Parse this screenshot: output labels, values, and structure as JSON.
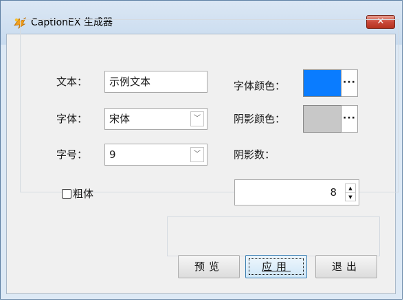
{
  "window": {
    "title": "CaptionEX 生成器",
    "close_glyph": "✕"
  },
  "form": {
    "text_label": "文本：",
    "text_value": "示例文本",
    "font_label": "字体：",
    "font_value": "宋体",
    "size_label": "字号：",
    "size_value": "9",
    "bold_label": "粗体",
    "bold_checked": false,
    "font_color_label": "字体颜色：",
    "font_color": "#0a7cff",
    "shadow_color_label": "阴影颜色：",
    "shadow_color": "#c8c8c8",
    "shadow_count_label": "阴影数：",
    "shadow_count_value": "8",
    "color_picker_glyph": "···"
  },
  "buttons": {
    "preview": "预览",
    "apply": "应用",
    "exit": "退出"
  }
}
